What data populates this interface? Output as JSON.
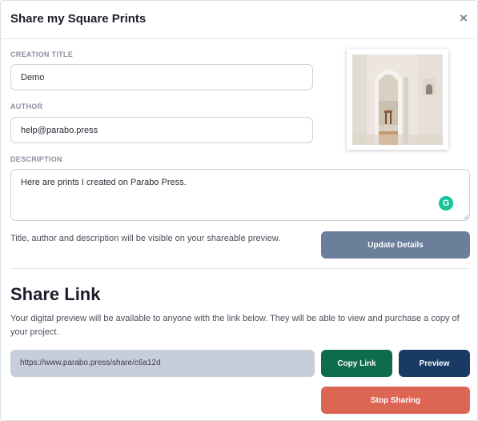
{
  "modal": {
    "title": "Share my Square Prints",
    "close_glyph": "×"
  },
  "form": {
    "creation_title_label": "CREATION TITLE",
    "creation_title_value": "Demo",
    "author_label": "AUTHOR",
    "author_value": "help@parabo.press",
    "description_label": "DESCRIPTION",
    "description_value": "Here are prints I created on Parabo Press.",
    "help_text": "Title, author and description will be visible on your shareable preview.",
    "update_button": "Update Details"
  },
  "thumbnail": {
    "icon": "print-thumbnail"
  },
  "grammarly": {
    "glyph": "G",
    "color": "#15c39a"
  },
  "share": {
    "heading": "Share Link",
    "description": "Your digital preview will be available to anyone with the link below. They will be able to view and purchase a copy of your project.",
    "link": "https://www.parabo.press/share/c6a12d",
    "copy_button": "Copy Link",
    "preview_button": "Preview",
    "stop_button": "Stop Sharing"
  },
  "colors": {
    "update": "#6b7f9b",
    "copy": "#0e6b4e",
    "preview": "#1a3a66",
    "stop": "#dd6554"
  }
}
